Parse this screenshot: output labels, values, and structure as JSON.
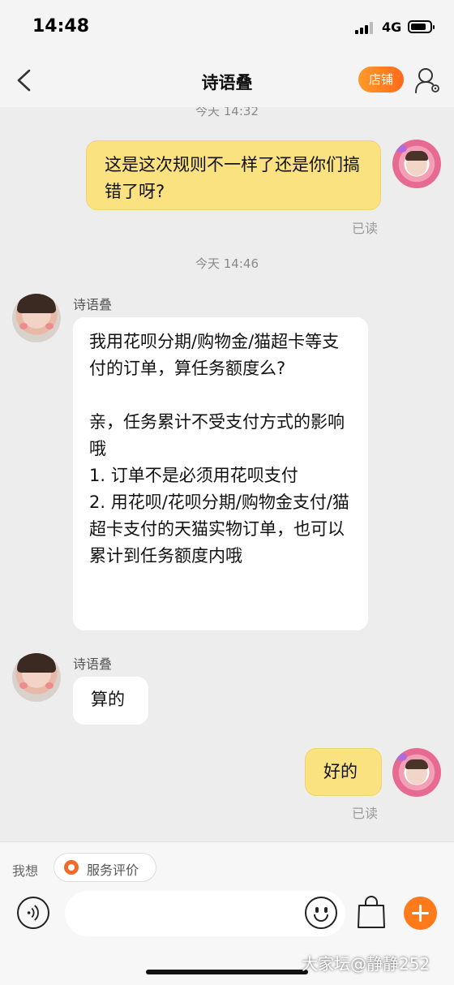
{
  "status_bar": {
    "time": "14:48",
    "network": "4G"
  },
  "header": {
    "title": "诗语叠",
    "store_label": "店铺"
  },
  "messages": [
    {
      "timestamp": "今天 14:32"
    },
    {
      "side": "right",
      "text": "这是这次规则不一样了还是你们搞错了呀?",
      "read": "已读"
    },
    {
      "timestamp": "今天 14:46"
    },
    {
      "side": "left",
      "sender": "诗语叠",
      "text": "我用花呗分期/购物金/猫超卡等支付的订单，算任务额度么?\n\n亲，任务累计不受支付方式的影响哦\n1. 订单不是必须用花呗支付\n2. 用花呗/花呗分期/购物金支付/猫超卡支付的天猫实物订单，也可以累计到任务额度内哦"
    },
    {
      "side": "left",
      "sender": "诗语叠",
      "text": "算的"
    },
    {
      "side": "right",
      "text": "好的",
      "read": "已读"
    }
  ],
  "bottom_bar": {
    "prompt": "我想",
    "chip_label": "服务评价"
  },
  "watermark": "大家坛@静静252",
  "colors": {
    "accent": "#ff7a1a",
    "bubble_self": "#fbe281",
    "bubble_other": "#ffffff",
    "background": "#ededed"
  },
  "icons": [
    "back-arrow-icon",
    "person-settings-icon",
    "voice-icon",
    "emoji-icon",
    "shopping-bag-icon",
    "plus-icon",
    "service-rating-icon"
  ]
}
